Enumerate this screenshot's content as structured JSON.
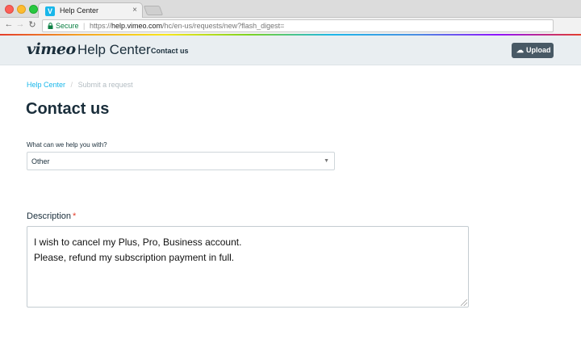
{
  "browser": {
    "tab_title": "Help Center",
    "tab_close": "×",
    "secure_label": "Secure",
    "url_prefix": "https://",
    "url_domain": "help.vimeo.com",
    "url_path": "/hc/en-us/requests/new?flash_digest="
  },
  "header": {
    "logo": "vimeo",
    "section": "Help Center",
    "nav_contact": "Contact us",
    "upload_label": "Upload"
  },
  "breadcrumb": {
    "home": "Help Center",
    "separator": "/",
    "current": "Submit a request"
  },
  "page": {
    "title": "Contact us",
    "question_label": "What can we help you with?",
    "selected_option": "Other",
    "description_label": "Description",
    "required_mark": "*",
    "description_value": "I wish to cancel my Plus, Pro, Business account.\nPlease, refund my subscription payment in full."
  },
  "colors": {
    "accent": "#19b7ea",
    "header_bg": "#e9eef1",
    "upload_bg": "#485965",
    "required": "#e43e2b"
  }
}
